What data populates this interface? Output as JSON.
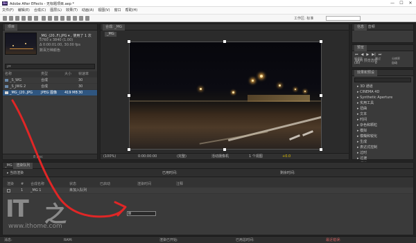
{
  "app": {
    "title": "Adobe After Effects - 无标题项目.aep *",
    "icon_text": "Ae"
  },
  "window_controls": {
    "minimize": "—",
    "maximize": "☐",
    "close": "✕"
  },
  "menu": [
    "文件(F)",
    "编辑(E)",
    "合成(C)",
    "图层(L)",
    "效果(T)",
    "动画(A)",
    "视图(V)",
    "窗口",
    "帮助(H)"
  ],
  "toolbar": {
    "workspace_label": "工作区:",
    "workspace_value": "标准"
  },
  "project_panel": {
    "tab": "项目",
    "preview_name": "_MG_(20..F).JPG ▾ , 使用了 1 次",
    "preview_dims": "5760 x 3840 (1.00)",
    "preview_meta": "Δ 0:00:01:00, 30.00 fps",
    "preview_color": "数百万种颜色",
    "search_placeholder": "ρ▾",
    "columns": [
      "名称",
      "类型",
      "大小",
      "帧速率"
    ],
    "rows": [
      {
        "name": "_S_WG",
        "type": "合成",
        "size": "",
        "fps": "30"
      },
      {
        "name": "_S_JWG 2",
        "type": "合成",
        "size": "",
        "fps": "30"
      },
      {
        "name": "_MG_(20..JPG",
        "type": "JPEG 图像",
        "size": "419 MB",
        "fps": "30"
      }
    ],
    "footer": "8 bpc"
  },
  "comp_panel": {
    "tab_label": "合成: _MG",
    "tab_chip": "_MG",
    "viewer_label": "_MG",
    "zoom": "(100%)",
    "timecode": "0:00:00:00",
    "quality": "(完整)",
    "camera": "活动摄像机",
    "views": "1 个视图",
    "exposure": "+0.0"
  },
  "right_panels": {
    "info_tab": "信息",
    "audio_tab": "音频",
    "preview_tab": "预览",
    "preview_label": "RAM 预览选项",
    "frame_rate_label": "帧速率",
    "skip_label": "跳过",
    "resolution_label": "分辨率",
    "frame_rate_value": "(30)",
    "skip_value": "0",
    "resolution_value": "自动",
    "effects_tab": "效果和预设",
    "effects": [
      "3D 通道",
      "CINEMA 4D",
      "Synthetic Aperture",
      "实用工具",
      "扭曲",
      "文本",
      "时间",
      "杂色和颗粒",
      "模拟",
      "模糊和锐化",
      "生成",
      "表达式控制",
      "过时",
      "过渡",
      "通道"
    ]
  },
  "timeline": {
    "tab": "_MG",
    "render_tab": "渲染队列",
    "current_render": "当前渲染",
    "elapsed_label": "已用时间:",
    "remaining_label": "剩余时间:",
    "columns": [
      "渲染",
      "#",
      "合成名称",
      "状态",
      "已启动",
      "渲染时间",
      "注释"
    ],
    "row": {
      "num": "1",
      "comp": "_MG 1",
      "status": "未加入队列"
    }
  },
  "status": {
    "message": "消息:",
    "ram": "RAM:",
    "renders_started": "渲染已开始:",
    "total_time": "已用总时间:",
    "log": "最近错误:"
  },
  "watermark": {
    "logo_text": "IT",
    "logo_glyph": "之",
    "url": "www.ithome.com"
  },
  "colors": {
    "annotation_red": "#e02626",
    "selection_blue": "#2f5680",
    "panel_bg": "#3a3a3a"
  }
}
